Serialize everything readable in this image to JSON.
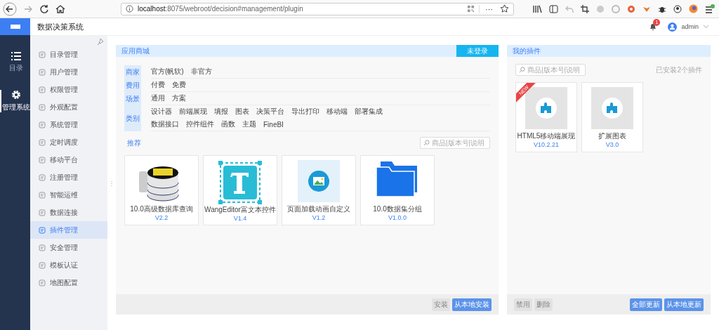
{
  "browser": {
    "url_host": "localhost",
    "url_path": ":8075/webroot/decision#management/plugin",
    "more": "···"
  },
  "app": {
    "title": "数据决策系统",
    "notifications": "1",
    "user": "admin"
  },
  "rail": [
    {
      "label": "目录",
      "kind": "list",
      "selected": false
    },
    {
      "label": "管理系统",
      "kind": "gear",
      "selected": true
    }
  ],
  "sidebar": {
    "items": [
      {
        "label": "目录管理",
        "selected": false
      },
      {
        "label": "用户管理",
        "selected": false
      },
      {
        "label": "权限管理",
        "selected": false
      },
      {
        "label": "外观配置",
        "selected": false
      },
      {
        "label": "系统管理",
        "selected": false
      },
      {
        "label": "定时调度",
        "selected": false
      },
      {
        "label": "移动平台",
        "selected": false
      },
      {
        "label": "注册管理",
        "selected": false
      },
      {
        "label": "智能运维",
        "selected": false
      },
      {
        "label": "数据连接",
        "selected": false
      },
      {
        "label": "插件管理",
        "selected": true
      },
      {
        "label": "安全管理",
        "selected": false
      },
      {
        "label": "模板认证",
        "selected": false
      },
      {
        "label": "地图配置",
        "selected": false
      }
    ]
  },
  "store": {
    "title": "应用商城",
    "login_button": "未登录",
    "filters": [
      {
        "label": "商家",
        "lines": [
          [
            "官方(帆软)",
            "非官方"
          ]
        ]
      },
      {
        "label": "费用",
        "lines": [
          [
            "付费",
            "免费"
          ]
        ]
      },
      {
        "label": "场景",
        "lines": [
          [
            "通用",
            "方案"
          ]
        ]
      },
      {
        "label": "类别",
        "lines": [
          [
            "设计器",
            "前端展现",
            "填报",
            "图表",
            "决策平台",
            "导出打印",
            "移动端",
            "部署集成"
          ],
          [
            "数据接口",
            "控件组件",
            "函数",
            "主题",
            "FineBI"
          ]
        ]
      }
    ],
    "recommend_label": "推荐",
    "search_placeholder": "商品|版本号|说明",
    "cards": [
      {
        "name": "10.0高级数据库查询",
        "version": "V2.2",
        "kind": "database"
      },
      {
        "name": "WangEditor富文本控件",
        "version": "V1.4",
        "kind": "text"
      },
      {
        "name": "页面加载动画自定义",
        "version": "V1.2",
        "kind": "image"
      },
      {
        "name": "10.0数据集分组",
        "version": "V1.0.0",
        "kind": "folder"
      }
    ],
    "buttons": [
      {
        "label": "安装",
        "kind": "secondary"
      },
      {
        "label": "从本地安装",
        "kind": "primary"
      }
    ]
  },
  "my_plugins": {
    "title": "我的插件",
    "search_placeholder": "商品|版本号|说明",
    "count": "已安装2个插件",
    "cards": [
      {
        "name": "HTML5移动端展现",
        "version": "V10.2.21",
        "badge": "NEW"
      },
      {
        "name": "扩展图表",
        "version": "V3.0"
      }
    ],
    "left_buttons": [
      {
        "label": "禁用",
        "kind": "secondary"
      },
      {
        "label": "删除",
        "kind": "secondary"
      }
    ],
    "right_buttons": [
      {
        "label": "全部更新",
        "kind": "primary"
      },
      {
        "label": "从本地更新",
        "kind": "primary"
      }
    ]
  }
}
